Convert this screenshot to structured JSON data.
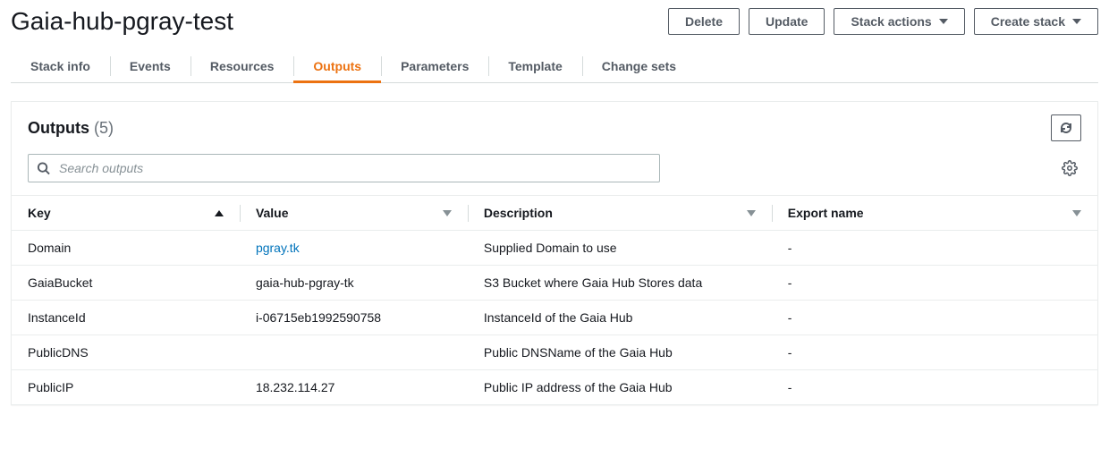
{
  "page_title": "Gaia-hub-pgray-test",
  "buttons": {
    "delete": "Delete",
    "update": "Update",
    "stack_actions": "Stack actions",
    "create_stack": "Create stack"
  },
  "tabs": [
    {
      "id": "stack-info",
      "label": "Stack info",
      "active": false
    },
    {
      "id": "events",
      "label": "Events",
      "active": false
    },
    {
      "id": "resources",
      "label": "Resources",
      "active": false
    },
    {
      "id": "outputs",
      "label": "Outputs",
      "active": true
    },
    {
      "id": "parameters",
      "label": "Parameters",
      "active": false
    },
    {
      "id": "template",
      "label": "Template",
      "active": false
    },
    {
      "id": "change-sets",
      "label": "Change sets",
      "active": false
    }
  ],
  "panel": {
    "title": "Outputs",
    "count_display": "(5)",
    "search_placeholder": "Search outputs"
  },
  "columns": {
    "key": "Key",
    "value": "Value",
    "description": "Description",
    "export_name": "Export name"
  },
  "rows": [
    {
      "key": "Domain",
      "value": "pgray.tk",
      "value_is_link": true,
      "description": "Supplied Domain to use",
      "export_name": "-"
    },
    {
      "key": "GaiaBucket",
      "value": "gaia-hub-pgray-tk",
      "value_is_link": false,
      "description": "S3 Bucket where Gaia Hub Stores data",
      "export_name": "-"
    },
    {
      "key": "InstanceId",
      "value": "i-06715eb1992590758",
      "value_is_link": false,
      "description": "InstanceId of the Gaia Hub",
      "export_name": "-"
    },
    {
      "key": "PublicDNS",
      "value": "",
      "value_is_link": false,
      "description": "Public DNSName of the Gaia Hub",
      "export_name": "-"
    },
    {
      "key": "PublicIP",
      "value": "18.232.114.27",
      "value_is_link": false,
      "description": "Public IP address of the Gaia Hub",
      "export_name": "-"
    }
  ]
}
